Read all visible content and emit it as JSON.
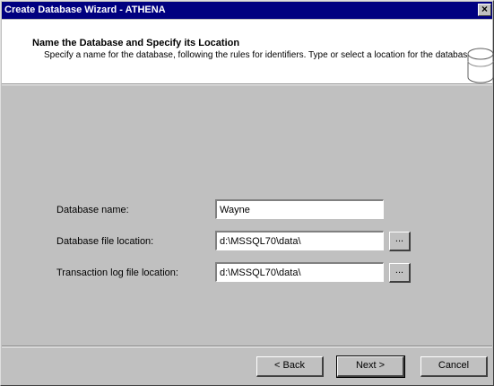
{
  "window": {
    "title": "Create Database Wizard - ATHENA",
    "close_label": "×"
  },
  "header": {
    "title": "Name the Database and Specify its Location",
    "description": "Specify a name for the database, following the rules for identifiers.  Type or select a location for the database.",
    "icon": "database-cylinder-icon"
  },
  "form": {
    "db_name": {
      "label": "Database name:",
      "value": "Wayne"
    },
    "db_file": {
      "label": "Database file location:",
      "value": "d:\\MSSQL70\\data\\",
      "browse_label": "..."
    },
    "log_file": {
      "label": "Transaction log file location:",
      "value": "d:\\MSSQL70\\data\\",
      "browse_label": "..."
    }
  },
  "buttons": {
    "back": "< Back",
    "next": "Next >",
    "cancel": "Cancel"
  }
}
